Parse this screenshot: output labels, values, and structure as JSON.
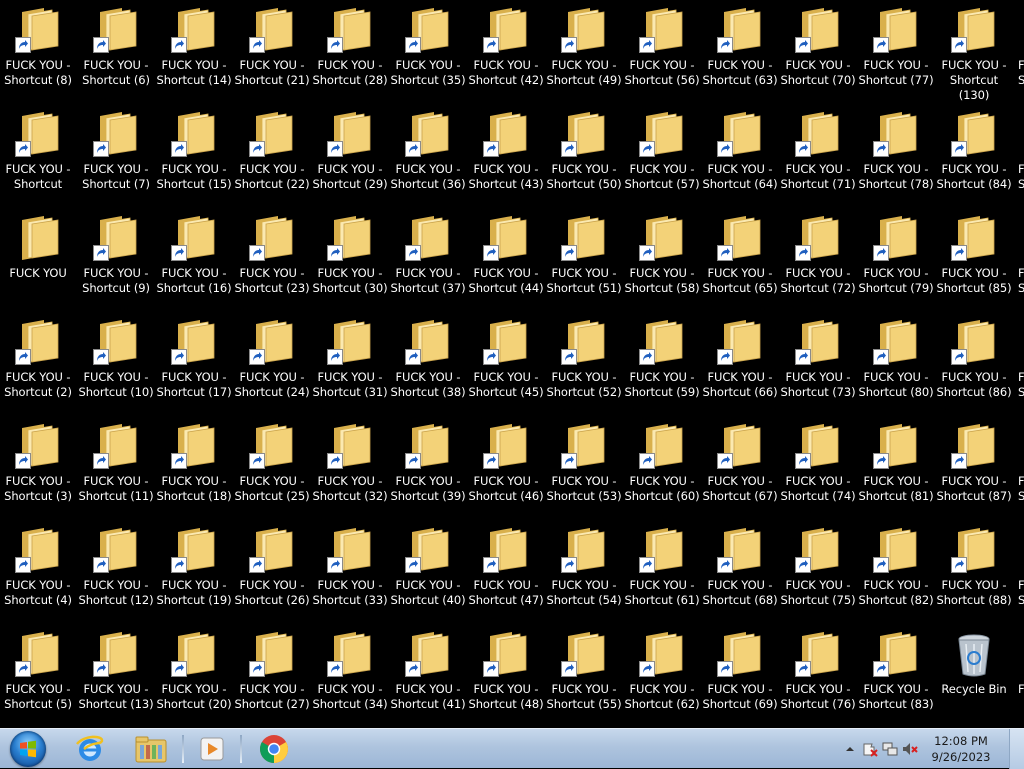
{
  "desktop": {
    "grid": [
      [
        "FUCK YOU -\nShortcut (8)",
        "FUCK YOU -\nShortcut",
        "FUCK YOU",
        "FUCK YOU -\nShortcut (2)",
        "FUCK YOU -\nShortcut (3)",
        "FUCK YOU -\nShortcut (4)",
        "FUCK YOU -\nShortcut (5)"
      ],
      [
        "FUCK YOU -\nShortcut (6)",
        "FUCK YOU -\nShortcut (7)",
        "FUCK YOU -\nShortcut (9)",
        "FUCK YOU -\nShortcut (10)",
        "FUCK YOU -\nShortcut (11)",
        "FUCK YOU -\nShortcut (12)",
        "FUCK YOU -\nShortcut (13)"
      ],
      [
        "FUCK YOU -\nShortcut (14)",
        "FUCK YOU -\nShortcut (15)",
        "FUCK YOU -\nShortcut (16)",
        "FUCK YOU -\nShortcut (17)",
        "FUCK YOU -\nShortcut (18)",
        "FUCK YOU -\nShortcut (19)",
        "FUCK YOU -\nShortcut (20)"
      ],
      [
        "FUCK YOU -\nShortcut (21)",
        "FUCK YOU -\nShortcut (22)",
        "FUCK YOU -\nShortcut (23)",
        "FUCK YOU -\nShortcut (24)",
        "FUCK YOU -\nShortcut (25)",
        "FUCK YOU -\nShortcut (26)",
        "FUCK YOU -\nShortcut (27)"
      ],
      [
        "FUCK YOU -\nShortcut (28)",
        "FUCK YOU -\nShortcut (29)",
        "FUCK YOU -\nShortcut (30)",
        "FUCK YOU -\nShortcut (31)",
        "FUCK YOU -\nShortcut (32)",
        "FUCK YOU -\nShortcut (33)",
        "FUCK YOU -\nShortcut (34)"
      ],
      [
        "FUCK YOU -\nShortcut (35)",
        "FUCK YOU -\nShortcut (36)",
        "FUCK YOU -\nShortcut (37)",
        "FUCK YOU -\nShortcut (38)",
        "FUCK YOU -\nShortcut (39)",
        "FUCK YOU -\nShortcut (40)",
        "FUCK YOU -\nShortcut (41)"
      ],
      [
        "FUCK YOU -\nShortcut (42)",
        "FUCK YOU -\nShortcut (43)",
        "FUCK YOU -\nShortcut (44)",
        "FUCK YOU -\nShortcut (45)",
        "FUCK YOU -\nShortcut (46)",
        "FUCK YOU -\nShortcut (47)",
        "FUCK YOU -\nShortcut (48)"
      ],
      [
        "FUCK YOU -\nShortcut (49)",
        "FUCK YOU -\nShortcut (50)",
        "FUCK YOU -\nShortcut (51)",
        "FUCK YOU -\nShortcut (52)",
        "FUCK YOU -\nShortcut (53)",
        "FUCK YOU -\nShortcut (54)",
        "FUCK YOU -\nShortcut (55)"
      ],
      [
        "FUCK YOU -\nShortcut (56)",
        "FUCK YOU -\nShortcut (57)",
        "FUCK YOU -\nShortcut (58)",
        "FUCK YOU -\nShortcut (59)",
        "FUCK YOU -\nShortcut (60)",
        "FUCK YOU -\nShortcut (61)",
        "FUCK YOU -\nShortcut (62)"
      ],
      [
        "FUCK YOU -\nShortcut (63)",
        "FUCK YOU -\nShortcut (64)",
        "FUCK YOU -\nShortcut (65)",
        "FUCK YOU -\nShortcut (66)",
        "FUCK YOU -\nShortcut (67)",
        "FUCK YOU -\nShortcut (68)",
        "FUCK YOU -\nShortcut (69)"
      ],
      [
        "FUCK YOU -\nShortcut (70)",
        "FUCK YOU -\nShortcut (71)",
        "FUCK YOU -\nShortcut (72)",
        "FUCK YOU -\nShortcut (73)",
        "FUCK YOU -\nShortcut (74)",
        "FUCK YOU -\nShortcut (75)",
        "FUCK YOU -\nShortcut (76)"
      ],
      [
        "FUCK YOU -\nShortcut (77)",
        "FUCK YOU -\nShortcut (78)",
        "FUCK YOU -\nShortcut (79)",
        "FUCK YOU -\nShortcut (80)",
        "FUCK YOU -\nShortcut (81)",
        "FUCK YOU -\nShortcut (82)",
        "FUCK YOU -\nShortcut (83)"
      ],
      [
        "FUCK YOU -\nShortcut (130)",
        "FUCK YOU -\nShortcut (84)",
        "FUCK YOU -\nShortcut (85)",
        "FUCK YOU -\nShortcut (86)",
        "FUCK YOU -\nShortcut (87)",
        "FUCK YOU -\nShortcut (88)",
        "Recycle Bin"
      ]
    ],
    "no_shortcut_arrow": [
      "FUCK YOU",
      "Recycle Bin"
    ],
    "recycle_bin_label": "Recycle Bin",
    "edge_fragments": [
      "F\nS",
      "F\nS",
      "F\nS",
      "F\nS",
      "F\nS",
      "F\nS",
      "F"
    ],
    "colors": {
      "background": "#000000",
      "folder": "#f3d278",
      "folder_dark": "#d9b04c",
      "shortcut_arrow": "#1f5fbf"
    }
  },
  "taskbar": {
    "start_icon": "windows-orb-icon",
    "pinned": [
      {
        "name": "internet-explorer-icon"
      },
      {
        "name": "windows-explorer-icon"
      },
      {
        "name": "windows-media-player-icon"
      },
      {
        "name": "google-chrome-icon"
      }
    ],
    "tray": {
      "icons": [
        "show-hidden-icons-icon",
        "action-center-icon",
        "network-icon",
        "volume-muted-icon"
      ],
      "time": "12:08 PM",
      "date": "9/26/2023"
    }
  }
}
